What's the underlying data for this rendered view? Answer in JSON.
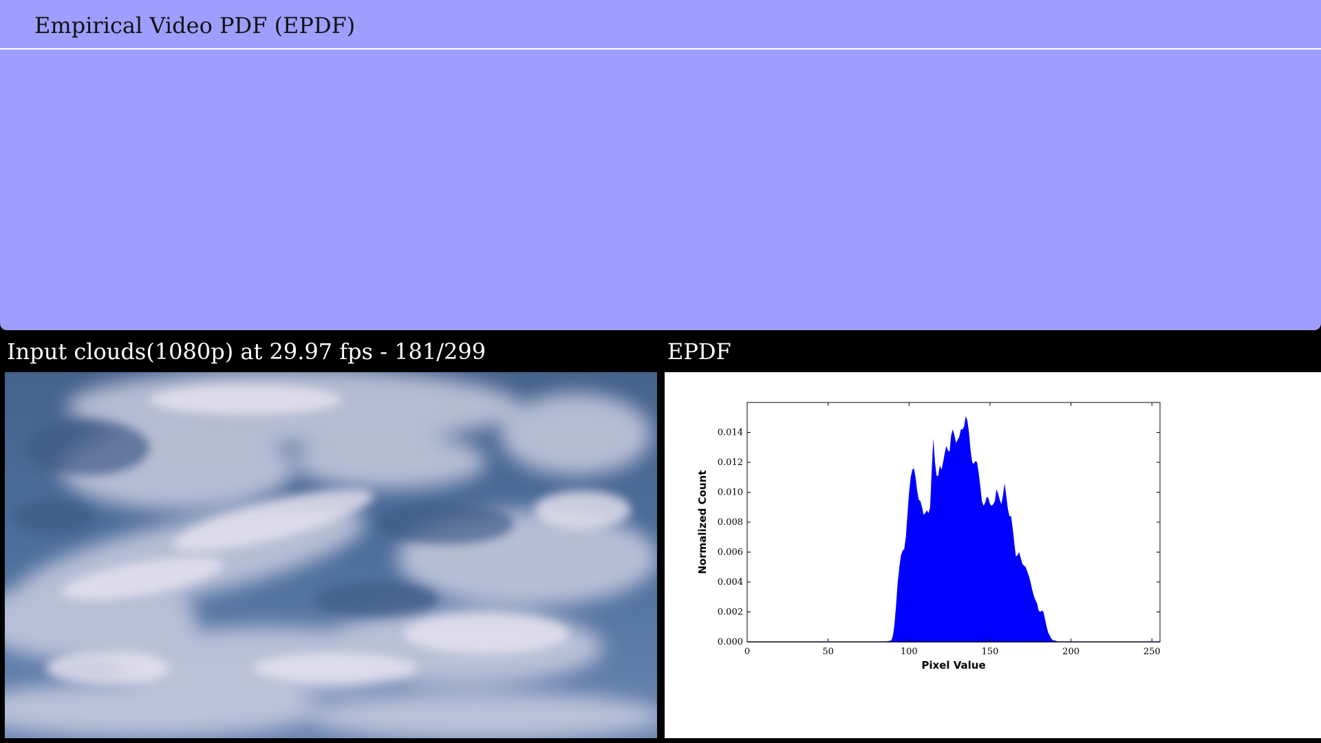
{
  "header": {
    "title": "Empirical Video PDF (EPDF)"
  },
  "input_panel": {
    "label": "Input clouds(1080p) at 29.97 fps - 181/299"
  },
  "epdf_panel": {
    "label": "EPDF"
  },
  "colors": {
    "header_bg": "#9e9eff",
    "page_bg": "#000000",
    "fill": "#0000ff"
  },
  "chart_data": {
    "type": "area",
    "title": "",
    "xlabel": "Pixel Value",
    "ylabel": "Normalized Count",
    "xlim": [
      0,
      255
    ],
    "ylim": [
      0,
      0.016
    ],
    "xticks": [
      0,
      50,
      100,
      150,
      200,
      250
    ],
    "yticks": [
      0.0,
      0.002,
      0.004,
      0.006,
      0.008,
      0.01,
      0.012,
      0.014
    ],
    "ytick_labels": [
      "0.000",
      "0.002",
      "0.004",
      "0.006",
      "0.008",
      "0.010",
      "0.012",
      "0.014"
    ],
    "x": [
      0,
      85,
      89,
      90,
      91,
      92,
      93,
      94,
      95,
      96,
      97,
      98,
      99,
      100,
      101,
      102,
      103,
      104,
      105,
      106,
      107,
      108,
      109,
      110,
      111,
      112,
      113,
      114,
      115,
      116,
      117,
      118,
      119,
      120,
      121,
      122,
      123,
      124,
      125,
      126,
      127,
      128,
      129,
      130,
      131,
      132,
      133,
      134,
      135,
      136,
      137,
      138,
      139,
      140,
      141,
      142,
      143,
      144,
      145,
      146,
      147,
      148,
      149,
      150,
      151,
      152,
      153,
      154,
      155,
      156,
      157,
      158,
      159,
      160,
      161,
      162,
      163,
      164,
      165,
      166,
      167,
      168,
      169,
      170,
      171,
      172,
      173,
      174,
      175,
      176,
      177,
      178,
      179,
      180,
      181,
      182,
      183,
      184,
      185,
      186,
      187,
      188,
      189,
      190,
      191,
      192,
      193,
      194,
      195,
      196,
      197,
      198,
      199,
      200,
      201,
      202,
      203,
      204,
      205,
      206,
      207,
      208,
      209,
      210,
      211,
      212,
      213,
      255
    ],
    "values": [
      0,
      0,
      0.0001,
      0.0004,
      0.0012,
      0.0025,
      0.004,
      0.005,
      0.0058,
      0.0061,
      0.0062,
      0.007,
      0.0085,
      0.01,
      0.011,
      0.0115,
      0.0116,
      0.011,
      0.0101,
      0.0095,
      0.0094,
      0.009,
      0.0085,
      0.0086,
      0.0088,
      0.0086,
      0.009,
      0.0115,
      0.0136,
      0.012,
      0.0111,
      0.0111,
      0.0118,
      0.0115,
      0.012,
      0.0126,
      0.0131,
      0.0128,
      0.0127,
      0.0138,
      0.0142,
      0.0138,
      0.0133,
      0.0135,
      0.0137,
      0.0142,
      0.0142,
      0.0144,
      0.0151,
      0.0148,
      0.014,
      0.0128,
      0.012,
      0.0119,
      0.0121,
      0.012,
      0.0113,
      0.0104,
      0.0094,
      0.0091,
      0.0093,
      0.0097,
      0.0096,
      0.0092,
      0.0091,
      0.0092,
      0.0094,
      0.0102,
      0.0099,
      0.0095,
      0.0092,
      0.0098,
      0.0106,
      0.0098,
      0.0089,
      0.0084,
      0.0084,
      0.0076,
      0.0066,
      0.0057,
      0.0058,
      0.006,
      0.0056,
      0.0052,
      0.0051,
      0.005,
      0.0047,
      0.0044,
      0.004,
      0.0035,
      0.0031,
      0.0028,
      0.0026,
      0.0021,
      0.002,
      0.0021,
      0.002,
      0.0015,
      0.001,
      0.0006,
      0.0004,
      0.0002,
      0.0001,
      0.0001,
      5e-05,
      2e-05,
      0,
      0,
      0,
      0,
      0,
      0,
      0,
      0,
      0,
      0,
      0,
      0,
      0,
      0,
      0,
      0,
      0,
      0,
      0,
      0,
      0,
      0
    ]
  }
}
